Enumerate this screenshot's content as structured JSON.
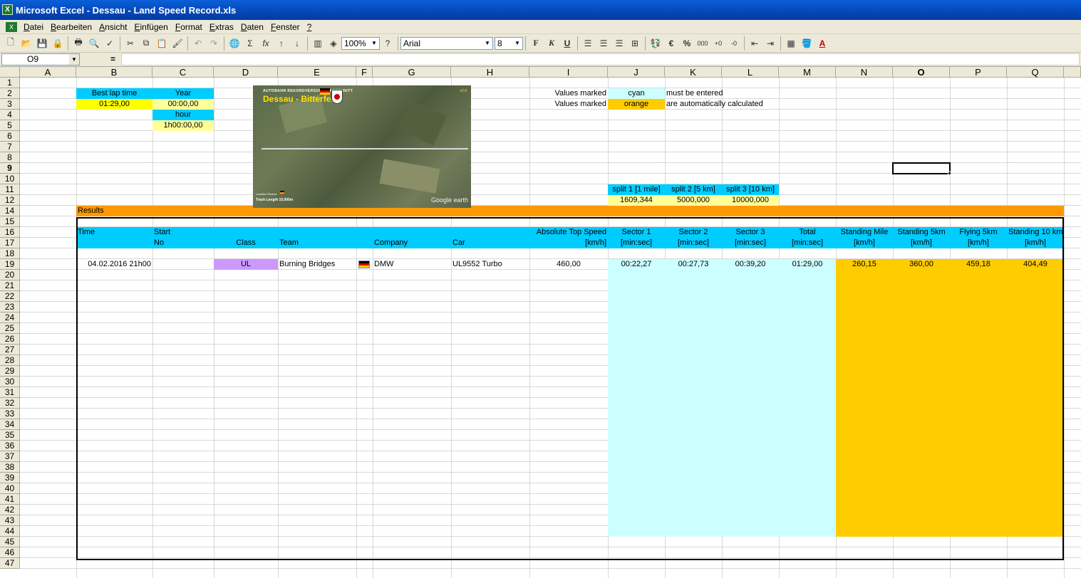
{
  "window": {
    "title": "Microsoft Excel - Dessau - Land Speed Record.xls"
  },
  "menu": [
    {
      "u": "D",
      "rest": "atei"
    },
    {
      "u": "B",
      "rest": "earbeiten"
    },
    {
      "u": "A",
      "rest": "nsicht"
    },
    {
      "u": "E",
      "rest": "infügen"
    },
    {
      "u": "F",
      "rest": "ormat"
    },
    {
      "u": "E",
      "rest": "xtras"
    },
    {
      "u": "D",
      "rest": "aten"
    },
    {
      "u": "F",
      "rest": "enster"
    },
    {
      "u": "?",
      "rest": ""
    }
  ],
  "toolbar": {
    "zoom": "100%",
    "font": "Arial",
    "font_size": "8",
    "bold": "F",
    "italic": "K",
    "underline": "U",
    "euro": "€",
    "percent": "%",
    "thousands": "000"
  },
  "formula_bar": {
    "name_box": "O9",
    "equals": "="
  },
  "columns": [
    "A",
    "B",
    "C",
    "D",
    "E",
    "F",
    "G",
    "H",
    "I",
    "J",
    "K",
    "L",
    "M",
    "N",
    "O",
    "P",
    "Q"
  ],
  "selected_column": "O",
  "rows": [
    "1",
    "2",
    "3",
    "4",
    "5",
    "6",
    "7",
    "8",
    "9",
    "10",
    "11",
    "12",
    "14",
    "15",
    "16",
    "17",
    "18",
    "19",
    "20",
    "21",
    "22",
    "23",
    "24",
    "25",
    "26",
    "27",
    "28",
    "29",
    "30",
    "31",
    "32",
    "33",
    "34",
    "35",
    "36",
    "37",
    "38",
    "39",
    "40",
    "41",
    "42",
    "43",
    "44",
    "45",
    "46",
    "47"
  ],
  "selected_row": "9",
  "cells": {
    "best_lap_label": "Best lap time",
    "best_lap_value": "01:29,00",
    "year_label": "Year",
    "year_value": "00:00,00",
    "hour_label": "hour",
    "hour_value": "1h00:00,00",
    "legend_label_1": "Values marked",
    "legend_color_1": "cyan",
    "legend_text_1": "must be entered",
    "legend_label_2": "Values marked",
    "legend_color_2": "orange",
    "legend_text_2": "are automatically calculated",
    "split1_label": "split 1 [1 mile]",
    "split2_label": "split 2 [5 km]",
    "split3_label": "split 3 [10 km]",
    "split1_value": "1609,344",
    "split2_value": "5000,000",
    "split3_value": "10000,000",
    "results_label": "Results"
  },
  "map": {
    "heading": "AUTOBAHN REKORDVERSUCHS-ABSCHNITT",
    "title": "Dessau - Bitterfeld",
    "version": "v2.8",
    "location_label": "Location Review",
    "track_length": "Track Length 10,000m",
    "provider": "Google earth"
  },
  "headers_top": {
    "time": "Time",
    "start": "Start",
    "top_speed": "Absolute Top Speed",
    "sector1": "Sector 1",
    "sector2": "Sector 2",
    "sector3": "Sector 3",
    "total": "Total",
    "standing_mile": "Standing Mile",
    "standing_5km": "Standing 5km",
    "flying_5km": "Flying 5km",
    "standing_10km": "Standing 10 km"
  },
  "headers_bottom": {
    "no": "No",
    "class": "Class",
    "team": "Team",
    "company": "Company",
    "car": "Car",
    "top_speed_unit": "[km/h]",
    "sector1_unit": "[min:sec]",
    "sector2_unit": "[min:sec]",
    "sector3_unit": "[min:sec]",
    "total_unit": "[min:sec]",
    "standing_mile_unit": "[km/h]",
    "standing_5km_unit": "[km/h]",
    "flying_5km_unit": "[km/h]",
    "standing_10km_unit": "[km/h]"
  },
  "result_row": {
    "time": "04.02.2016 21h00",
    "class": "UL",
    "team": "Burning Bridges",
    "company": "DMW",
    "car": "UL9552 Turbo",
    "top_speed": "460,00",
    "sector1": "00:22,27",
    "sector2": "00:27,73",
    "sector3": "00:39,20",
    "total": "01:29,00",
    "standing_mile": "260,15",
    "standing_5km": "360,00",
    "flying_5km": "459,18",
    "standing_10km": "404,49"
  },
  "colors": {
    "cyan_header": "#00ccff",
    "light_cyan": "#ccffff",
    "light_yellow": "#ffff99",
    "yellow": "#ffff00",
    "orange": "#ff9900",
    "gold": "#ffcc00",
    "lavender": "#cc99ff"
  }
}
